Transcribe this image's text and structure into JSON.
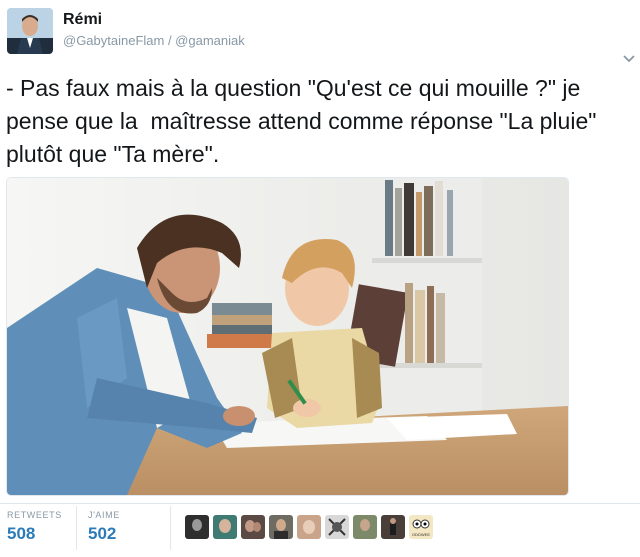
{
  "user": {
    "name": "Rémi",
    "handles": "@GabytaineFlam / @gamaniak"
  },
  "tweet": {
    "text": "- Pas faux mais à la question \"Qu'est ce qui mouille ?\" je pense que la  maîtresse attend comme réponse \"La pluie\" plutôt que \"Ta mère\"."
  },
  "stats": {
    "retweets_label": "RETWEETS",
    "retweets_value": "508",
    "likes_label": "J'AIME",
    "likes_value": "502"
  },
  "likers": [
    {
      "name": "liker-avatar-1",
      "color": "#2e2e2e"
    },
    {
      "name": "liker-avatar-2",
      "color": "#3f7a73"
    },
    {
      "name": "liker-avatar-3",
      "color": "#5b4a44"
    },
    {
      "name": "liker-avatar-4",
      "color": "#6e6b62"
    },
    {
      "name": "liker-avatar-5",
      "color": "#c9a48a"
    },
    {
      "name": "liker-avatar-6",
      "color": "#d8d8d8"
    },
    {
      "name": "liker-avatar-7",
      "color": "#7c8a6a"
    },
    {
      "name": "liker-avatar-8",
      "color": "#4a3f38"
    },
    {
      "name": "liker-avatar-9",
      "color": "#f3e7c4",
      "logo": "ODDWEE"
    }
  ],
  "colors": {
    "accent": "#2b7bb9",
    "muted": "#8899a6"
  }
}
